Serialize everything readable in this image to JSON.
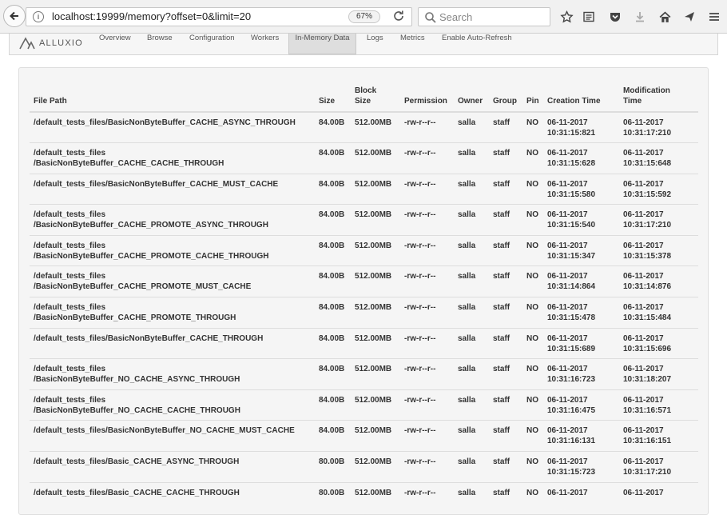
{
  "browser": {
    "url": "localhost:19999/memory?offset=0&limit=20",
    "zoom": "67%",
    "search_placeholder": "Search"
  },
  "nav": {
    "brand": "ALLUXIO",
    "items": [
      "Overview",
      "Browse",
      "Configuration",
      "Workers",
      "In-Memory Data",
      "Logs",
      "Metrics",
      "Enable Auto-Refresh"
    ],
    "active": "In-Memory Data"
  },
  "table": {
    "headers": {
      "path": "File Path",
      "size": "Size",
      "block1": "Block",
      "block2": "Size",
      "permission": "Permission",
      "owner": "Owner",
      "group": "Group",
      "pin": "Pin",
      "ctime": "Creation Time",
      "mtime1": "Modification",
      "mtime2": "Time"
    },
    "rows": [
      {
        "path1": "/default_tests_files/BasicNonByteBuffer_CACHE_ASYNC_THROUGH",
        "path2": "",
        "size": "84.00B",
        "block": "512.00MB",
        "perm": "-rw-r--r--",
        "owner": "salla",
        "group": "staff",
        "pin": "NO",
        "cdate": "06-11-2017",
        "ctime": "10:31:15:821",
        "mdate": "06-11-2017",
        "mtime": "10:31:17:210"
      },
      {
        "path1": "/default_tests_files",
        "path2": "/BasicNonByteBuffer_CACHE_CACHE_THROUGH",
        "size": "84.00B",
        "block": "512.00MB",
        "perm": "-rw-r--r--",
        "owner": "salla",
        "group": "staff",
        "pin": "NO",
        "cdate": "06-11-2017",
        "ctime": "10:31:15:628",
        "mdate": "06-11-2017",
        "mtime": "10:31:15:648"
      },
      {
        "path1": "/default_tests_files/BasicNonByteBuffer_CACHE_MUST_CACHE",
        "path2": "",
        "size": "84.00B",
        "block": "512.00MB",
        "perm": "-rw-r--r--",
        "owner": "salla",
        "group": "staff",
        "pin": "NO",
        "cdate": "06-11-2017",
        "ctime": "10:31:15:580",
        "mdate": "06-11-2017",
        "mtime": "10:31:15:592"
      },
      {
        "path1": "/default_tests_files",
        "path2": "/BasicNonByteBuffer_CACHE_PROMOTE_ASYNC_THROUGH",
        "size": "84.00B",
        "block": "512.00MB",
        "perm": "-rw-r--r--",
        "owner": "salla",
        "group": "staff",
        "pin": "NO",
        "cdate": "06-11-2017",
        "ctime": "10:31:15:540",
        "mdate": "06-11-2017",
        "mtime": "10:31:17:210"
      },
      {
        "path1": "/default_tests_files",
        "path2": "/BasicNonByteBuffer_CACHE_PROMOTE_CACHE_THROUGH",
        "size": "84.00B",
        "block": "512.00MB",
        "perm": "-rw-r--r--",
        "owner": "salla",
        "group": "staff",
        "pin": "NO",
        "cdate": "06-11-2017",
        "ctime": "10:31:15:347",
        "mdate": "06-11-2017",
        "mtime": "10:31:15:378"
      },
      {
        "path1": "/default_tests_files",
        "path2": "/BasicNonByteBuffer_CACHE_PROMOTE_MUST_CACHE",
        "size": "84.00B",
        "block": "512.00MB",
        "perm": "-rw-r--r--",
        "owner": "salla",
        "group": "staff",
        "pin": "NO",
        "cdate": "06-11-2017",
        "ctime": "10:31:14:864",
        "mdate": "06-11-2017",
        "mtime": "10:31:14:876"
      },
      {
        "path1": "/default_tests_files",
        "path2": "/BasicNonByteBuffer_CACHE_PROMOTE_THROUGH",
        "size": "84.00B",
        "block": "512.00MB",
        "perm": "-rw-r--r--",
        "owner": "salla",
        "group": "staff",
        "pin": "NO",
        "cdate": "06-11-2017",
        "ctime": "10:31:15:478",
        "mdate": "06-11-2017",
        "mtime": "10:31:15:484"
      },
      {
        "path1": "/default_tests_files/BasicNonByteBuffer_CACHE_THROUGH",
        "path2": "",
        "size": "84.00B",
        "block": "512.00MB",
        "perm": "-rw-r--r--",
        "owner": "salla",
        "group": "staff",
        "pin": "NO",
        "cdate": "06-11-2017",
        "ctime": "10:31:15:689",
        "mdate": "06-11-2017",
        "mtime": "10:31:15:696"
      },
      {
        "path1": "/default_tests_files",
        "path2": "/BasicNonByteBuffer_NO_CACHE_ASYNC_THROUGH",
        "size": "84.00B",
        "block": "512.00MB",
        "perm": "-rw-r--r--",
        "owner": "salla",
        "group": "staff",
        "pin": "NO",
        "cdate": "06-11-2017",
        "ctime": "10:31:16:723",
        "mdate": "06-11-2017",
        "mtime": "10:31:18:207"
      },
      {
        "path1": "/default_tests_files",
        "path2": "/BasicNonByteBuffer_NO_CACHE_CACHE_THROUGH",
        "size": "84.00B",
        "block": "512.00MB",
        "perm": "-rw-r--r--",
        "owner": "salla",
        "group": "staff",
        "pin": "NO",
        "cdate": "06-11-2017",
        "ctime": "10:31:16:475",
        "mdate": "06-11-2017",
        "mtime": "10:31:16:571"
      },
      {
        "path1": "/default_tests_files/BasicNonByteBuffer_NO_CACHE_MUST_CACHE",
        "path2": "",
        "size": "84.00B",
        "block": "512.00MB",
        "perm": "-rw-r--r--",
        "owner": "salla",
        "group": "staff",
        "pin": "NO",
        "cdate": "06-11-2017",
        "ctime": "10:31:16:131",
        "mdate": "06-11-2017",
        "mtime": "10:31:16:151"
      },
      {
        "path1": "/default_tests_files/Basic_CACHE_ASYNC_THROUGH",
        "path2": "",
        "size": "80.00B",
        "block": "512.00MB",
        "perm": "-rw-r--r--",
        "owner": "salla",
        "group": "staff",
        "pin": "NO",
        "cdate": "06-11-2017",
        "ctime": "10:31:15:723",
        "mdate": "06-11-2017",
        "mtime": "10:31:17:210"
      },
      {
        "path1": "/default_tests_files/Basic_CACHE_CACHE_THROUGH",
        "path2": "",
        "size": "80.00B",
        "block": "512.00MB",
        "perm": "-rw-r--r--",
        "owner": "salla",
        "group": "staff",
        "pin": "NO",
        "cdate": "06-11-2017",
        "ctime": "",
        "mdate": "06-11-2017",
        "mtime": ""
      }
    ]
  }
}
